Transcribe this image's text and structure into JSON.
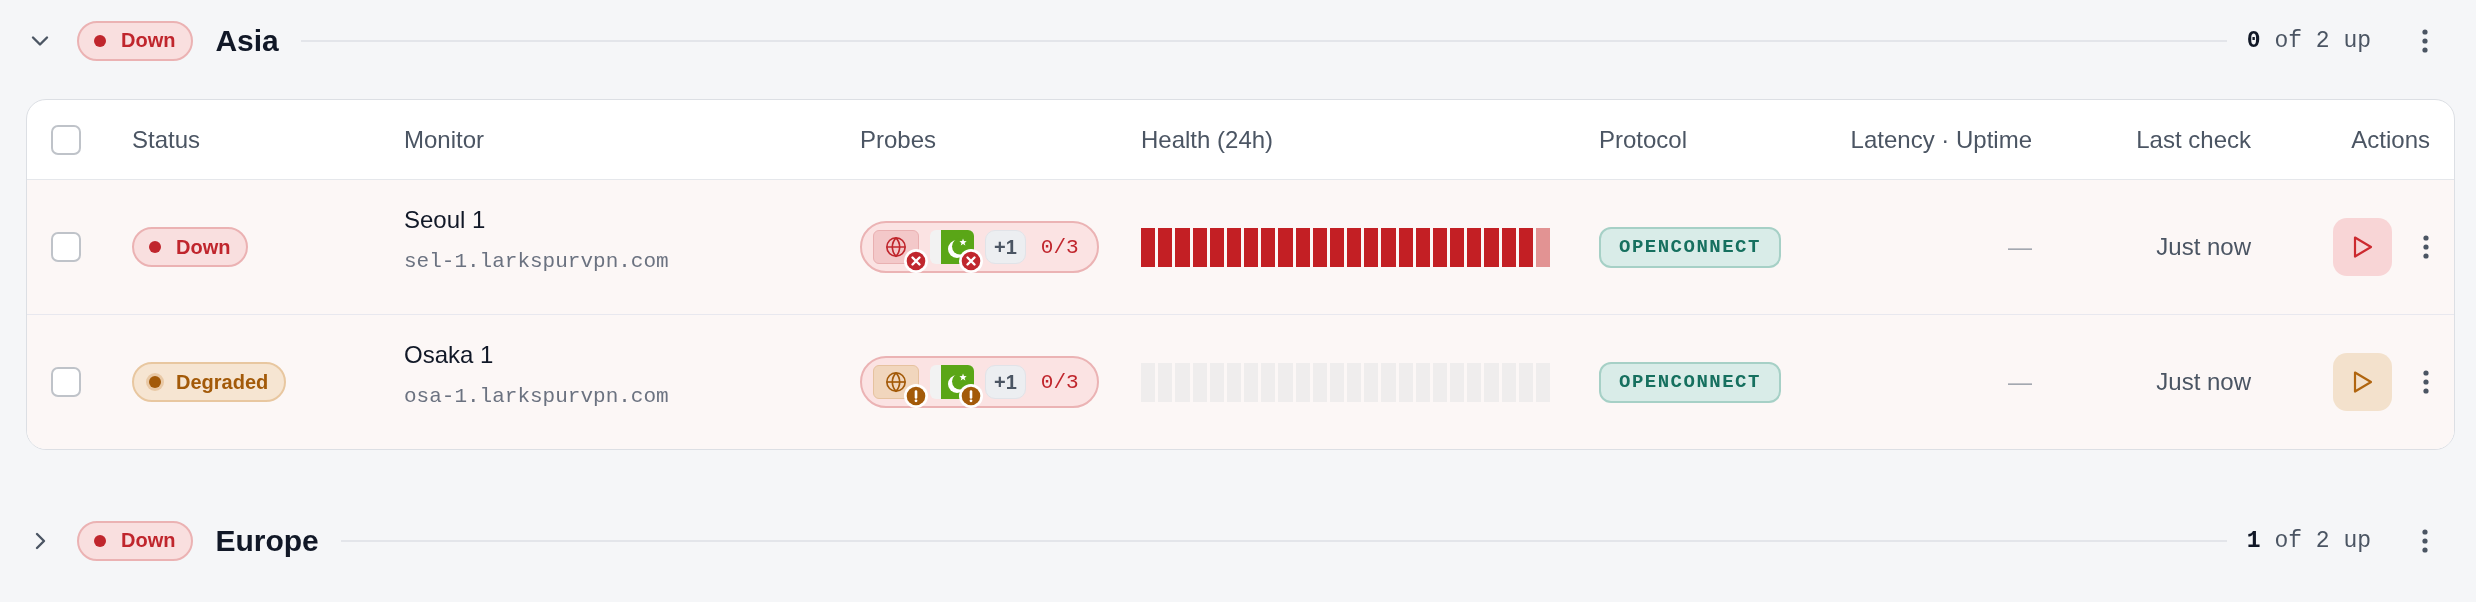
{
  "groups": [
    {
      "name": "Asia",
      "expanded": true,
      "status": {
        "kind": "down",
        "label": "Down"
      },
      "summary": "**0** of 2 up",
      "table": {
        "select_all": {
          "checked": false
        },
        "columns": [
          "Status",
          "Monitor",
          "Probes",
          "Health (24h)",
          "Protocol",
          "Latency · Uptime",
          "Last check",
          "Actions"
        ],
        "rows": [
          {
            "checked": false,
            "status": {
              "kind": "down",
              "label": "Down"
            },
            "name": "Seoul 1",
            "host": "sel-1.larkspurvpn.com",
            "probes": {
              "items": [
                {
                  "kind": "globe",
                  "status": {
                    "kind": "down"
                  }
                },
                {
                  "kind": "flag",
                  "status": {
                    "kind": "down"
                  }
                }
              ],
              "more": "+1",
              "ratio": "0/3"
            },
            "health": [
              {
                "kind": "down"
              },
              {
                "kind": "down"
              },
              {
                "kind": "down"
              },
              {
                "kind": "down"
              },
              {
                "kind": "down"
              },
              {
                "kind": "down"
              },
              {
                "kind": "down"
              },
              {
                "kind": "down"
              },
              {
                "kind": "down"
              },
              {
                "kind": "down"
              },
              {
                "kind": "down"
              },
              {
                "kind": "down"
              },
              {
                "kind": "down"
              },
              {
                "kind": "down"
              },
              {
                "kind": "down"
              },
              {
                "kind": "down"
              },
              {
                "kind": "down"
              },
              {
                "kind": "down"
              },
              {
                "kind": "down"
              },
              {
                "kind": "down"
              },
              {
                "kind": "down"
              },
              {
                "kind": "down"
              },
              {
                "kind": "down"
              },
              {
                "kind": "partial"
              }
            ],
            "protocol": "OPENCONNECT",
            "latency": "—",
            "last_check": "Just now"
          },
          {
            "checked": false,
            "status": {
              "kind": "degraded",
              "label": "Degraded"
            },
            "name": "Osaka 1",
            "host": "osa-1.larkspurvpn.com",
            "probes": {
              "items": [
                {
                  "kind": "globe",
                  "status": {
                    "kind": "degraded"
                  }
                },
                {
                  "kind": "flag",
                  "status": {
                    "kind": "degraded"
                  }
                }
              ],
              "more": "+1",
              "ratio": "0/3"
            },
            "health": [
              {
                "kind": "none"
              },
              {
                "kind": "none"
              },
              {
                "kind": "none"
              },
              {
                "kind": "none"
              },
              {
                "kind": "none"
              },
              {
                "kind": "none"
              },
              {
                "kind": "none"
              },
              {
                "kind": "none"
              },
              {
                "kind": "none"
              },
              {
                "kind": "none"
              },
              {
                "kind": "none"
              },
              {
                "kind": "none"
              },
              {
                "kind": "none"
              },
              {
                "kind": "none"
              },
              {
                "kind": "none"
              },
              {
                "kind": "none"
              },
              {
                "kind": "none"
              },
              {
                "kind": "none"
              },
              {
                "kind": "none"
              },
              {
                "kind": "none"
              },
              {
                "kind": "none"
              },
              {
                "kind": "none"
              },
              {
                "kind": "none"
              },
              {
                "kind": "none"
              }
            ],
            "protocol": "OPENCONNECT",
            "latency": "—",
            "last_check": "Just now"
          }
        ]
      }
    },
    {
      "name": "Europe",
      "expanded": false,
      "status": {
        "kind": "down",
        "label": "Down"
      },
      "summary": "**1** of 2 up"
    }
  ]
}
